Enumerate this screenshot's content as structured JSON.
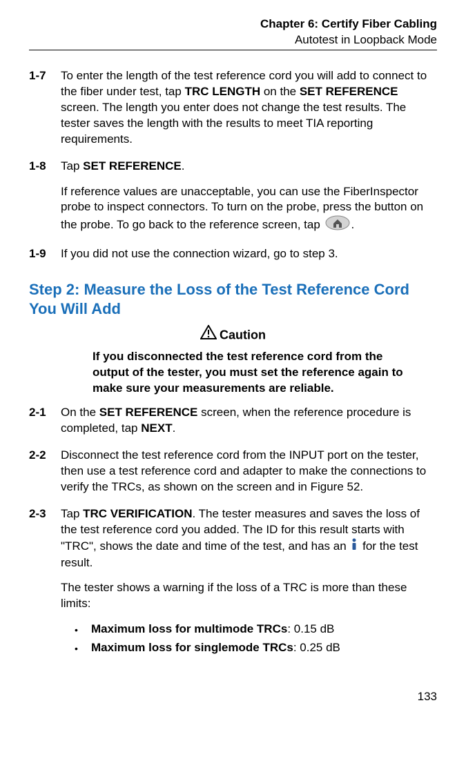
{
  "header": {
    "chapter": "Chapter 6: Certify Fiber Cabling",
    "section": "Autotest in Loopback Mode"
  },
  "step1": {
    "item7": {
      "num": "1-7",
      "text_before": "To enter the length of the test reference cord you will add to connect to the fiber under test, tap ",
      "bold1": "TRC LENGTH",
      "text_mid1": " on the ",
      "bold2": "SET REFERENCE",
      "text_after": " screen. The length you enter does not change the test results. The tester saves the length with the results to meet TIA reporting requirements."
    },
    "item8": {
      "num": "1-8",
      "p1_before": "Tap ",
      "p1_bold": "SET REFERENCE",
      "p1_after": ".",
      "p2": "If reference values are unacceptable, you can use the FiberInspector probe to inspect connectors. To turn on the probe, press the button on the probe. To go back to the reference screen, tap ",
      "p2_after": "."
    },
    "item9": {
      "num": "1-9",
      "text": "If you did not use the connection wizard, go to step 3."
    }
  },
  "step2_heading": "Step 2: Measure the Loss of the Test Reference Cord You Will Add",
  "caution": {
    "label": "Caution",
    "body": "If you disconnected the test reference cord from the output of the tester, you must set the reference again to make sure your measurements are reliable."
  },
  "step2": {
    "item1": {
      "num": "2-1",
      "before": "On the ",
      "bold1": "SET REFERENCE",
      "mid": " screen, when the reference procedure is completed, tap ",
      "bold2": "NEXT",
      "after": "."
    },
    "item2": {
      "num": "2-2",
      "text": "Disconnect the test reference cord from the INPUT port on the tester, then use a test reference cord and adapter to make the connections to verify the TRCs, as shown on the screen and in Figure 52."
    },
    "item3": {
      "num": "2-3",
      "p1_before": "Tap ",
      "p1_bold": "TRC VERIFICATION",
      "p1_mid": ". The tester measures and saves the loss of the test reference cord you added. The ID for this result starts with \"TRC\", shows the date and time of the test, and has an ",
      "p1_after": " for the test result.",
      "p2": "The tester shows a warning if the loss of a TRC is more than these limits:",
      "bullet1_bold": "Maximum loss for multimode TRCs",
      "bullet1_after": ": 0.15 dB",
      "bullet2_bold": "Maximum loss for singlemode TRCs",
      "bullet2_after": ": 0.25 dB"
    }
  },
  "page_number": "133"
}
